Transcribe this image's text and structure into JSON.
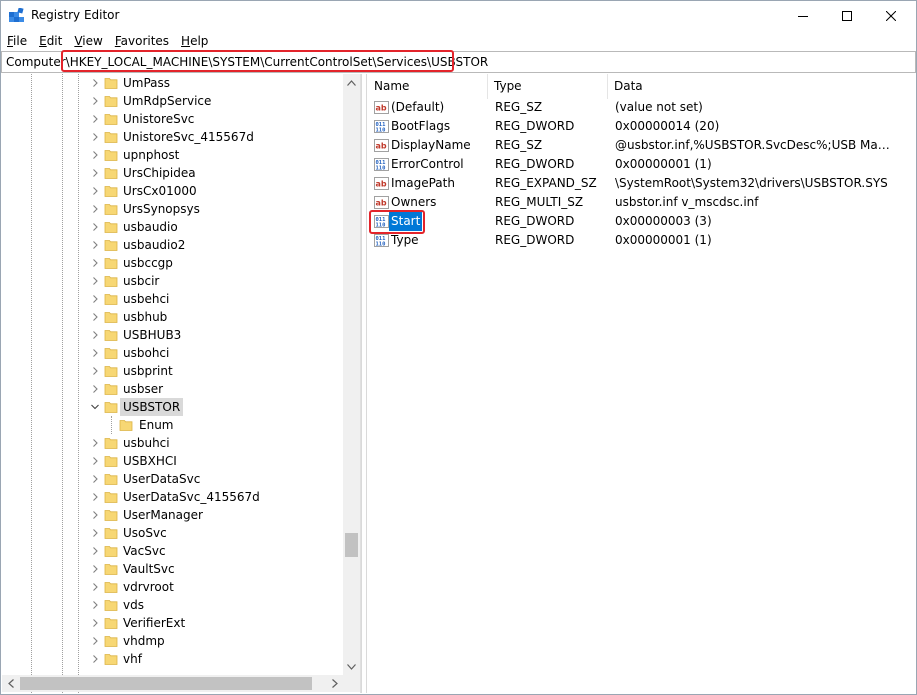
{
  "window": {
    "title": "Registry Editor",
    "accent": "#0078d7"
  },
  "menu": [
    {
      "label": "File",
      "u": "F",
      "rest": "ile"
    },
    {
      "label": "Edit",
      "u": "E",
      "rest": "dit"
    },
    {
      "label": "View",
      "u": "V",
      "rest": "iew"
    },
    {
      "label": "Favorites",
      "u": "F",
      "rest": "avorites",
      "pre": ""
    },
    {
      "label": "Help",
      "u": "H",
      "rest": "elp"
    }
  ],
  "address": {
    "prefix": "Computer\\",
    "path": "HKEY_LOCAL_MACHINE\\SYSTEM\\CurrentControlSet\\Services\\USBSTOR"
  },
  "tree": {
    "items": [
      {
        "label": "UmPass",
        "expandable": true
      },
      {
        "label": "UmRdpService",
        "expandable": true
      },
      {
        "label": "UnistoreSvc",
        "expandable": true
      },
      {
        "label": "UnistoreSvc_415567d",
        "expandable": true
      },
      {
        "label": "upnphost",
        "expandable": true
      },
      {
        "label": "UrsChipidea",
        "expandable": true
      },
      {
        "label": "UrsCx01000",
        "expandable": true
      },
      {
        "label": "UrsSynopsys",
        "expandable": true
      },
      {
        "label": "usbaudio",
        "expandable": true
      },
      {
        "label": "usbaudio2",
        "expandable": true
      },
      {
        "label": "usbccgp",
        "expandable": true
      },
      {
        "label": "usbcir",
        "expandable": true
      },
      {
        "label": "usbehci",
        "expandable": true
      },
      {
        "label": "usbhub",
        "expandable": true
      },
      {
        "label": "USBHUB3",
        "expandable": true
      },
      {
        "label": "usbohci",
        "expandable": true
      },
      {
        "label": "usbprint",
        "expandable": true
      },
      {
        "label": "usbser",
        "expandable": true
      },
      {
        "label": "USBSTOR",
        "expandable": true,
        "expanded": true,
        "selected": true
      },
      {
        "label": "Enum",
        "expandable": false,
        "child": true
      },
      {
        "label": "usbuhci",
        "expandable": true
      },
      {
        "label": "USBXHCI",
        "expandable": true
      },
      {
        "label": "UserDataSvc",
        "expandable": true
      },
      {
        "label": "UserDataSvc_415567d",
        "expandable": true
      },
      {
        "label": "UserManager",
        "expandable": true
      },
      {
        "label": "UsoSvc",
        "expandable": true
      },
      {
        "label": "VacSvc",
        "expandable": true
      },
      {
        "label": "VaultSvc",
        "expandable": true
      },
      {
        "label": "vdrvroot",
        "expandable": true
      },
      {
        "label": "vds",
        "expandable": true
      },
      {
        "label": "VerifierExt",
        "expandable": true
      },
      {
        "label": "vhdmp",
        "expandable": true
      },
      {
        "label": "vhf",
        "expandable": true
      }
    ]
  },
  "list": {
    "columns": {
      "name": "Name",
      "type": "Type",
      "data": "Data"
    },
    "rows": [
      {
        "name": "(Default)",
        "type": "REG_SZ",
        "data": "(value not set)",
        "icon": "string-value-icon"
      },
      {
        "name": "BootFlags",
        "type": "REG_DWORD",
        "data": "0x00000014 (20)",
        "icon": "binary-value-icon"
      },
      {
        "name": "DisplayName",
        "type": "REG_SZ",
        "data": "@usbstor.inf,%USBSTOR.SvcDesc%;USB Mass Stor…",
        "icon": "string-value-icon"
      },
      {
        "name": "ErrorControl",
        "type": "REG_DWORD",
        "data": "0x00000001 (1)",
        "icon": "binary-value-icon"
      },
      {
        "name": "ImagePath",
        "type": "REG_EXPAND_SZ",
        "data": "\\SystemRoot\\System32\\drivers\\USBSTOR.SYS",
        "icon": "string-value-icon"
      },
      {
        "name": "Owners",
        "type": "REG_MULTI_SZ",
        "data": "usbstor.inf v_mscdsc.inf",
        "icon": "string-value-icon"
      },
      {
        "name": "Start",
        "type": "REG_DWORD",
        "data": "0x00000003 (3)",
        "icon": "binary-value-icon",
        "selected": true
      },
      {
        "name": "Type",
        "type": "REG_DWORD",
        "data": "0x00000001 (1)",
        "icon": "binary-value-icon"
      }
    ]
  },
  "colors": {
    "highlight": "#e3242b",
    "folder": "#f7d774",
    "folder_edge": "#dcb445"
  }
}
